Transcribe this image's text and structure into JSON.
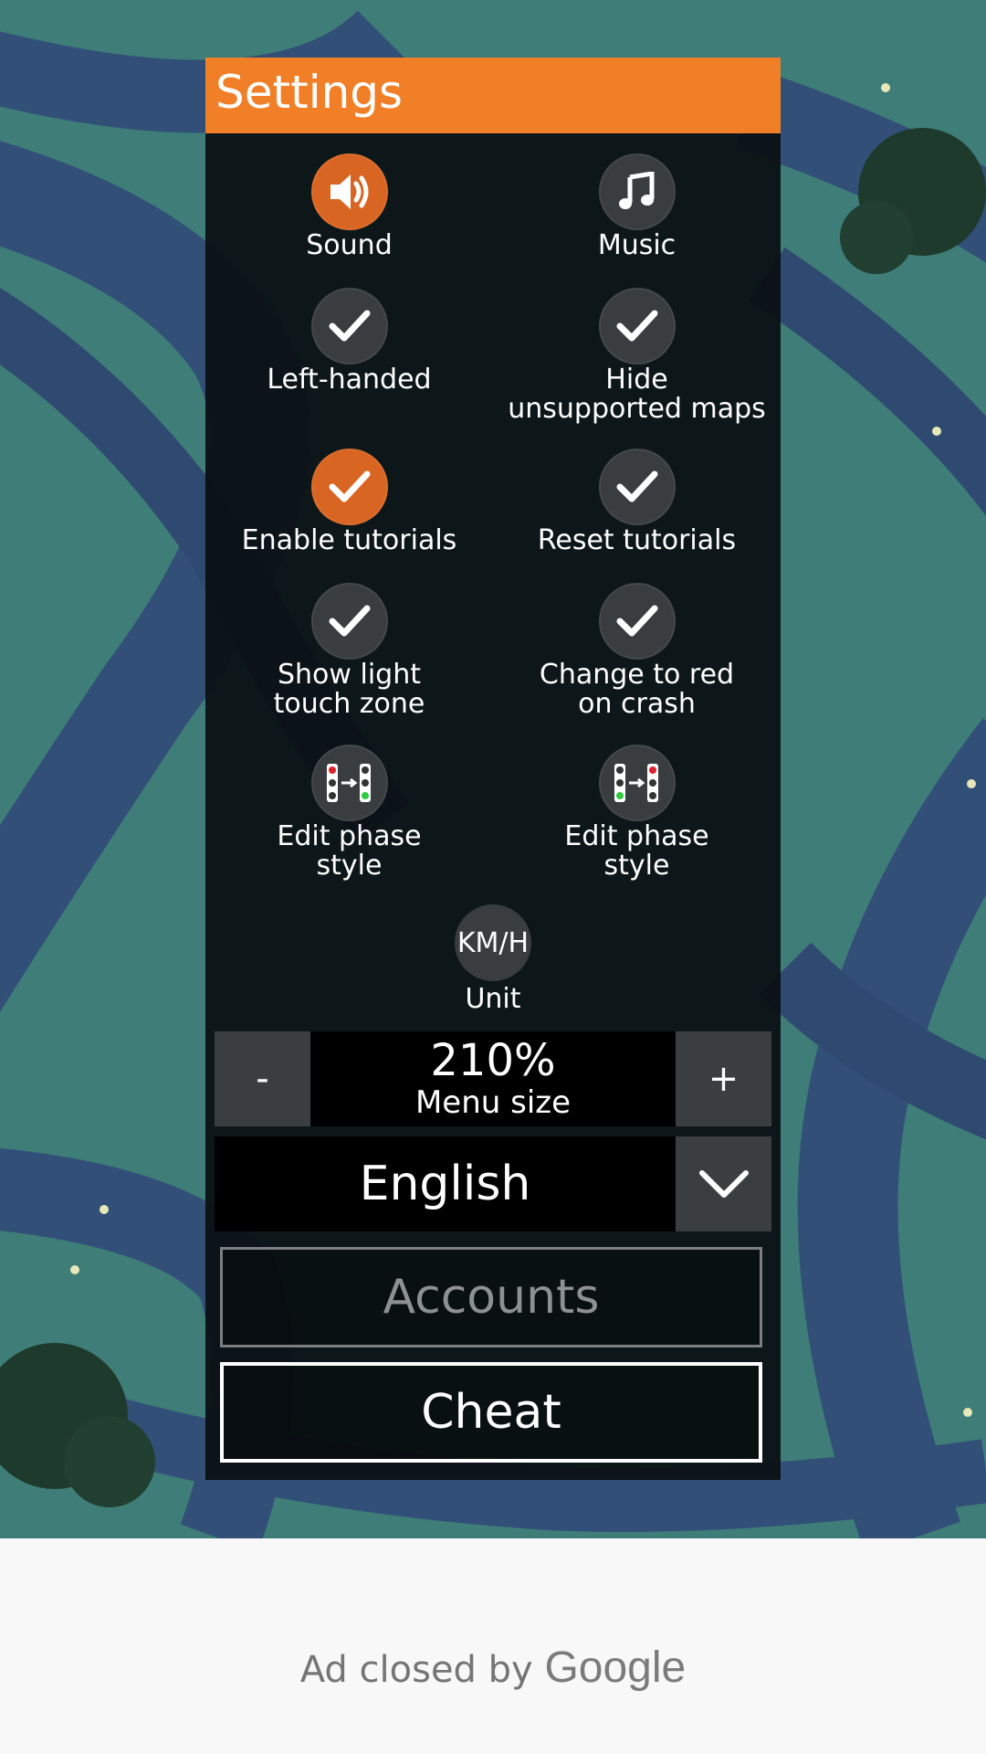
{
  "settings": {
    "title": "Settings",
    "options": [
      {
        "label": "Sound",
        "icon": "speaker-icon",
        "active": true
      },
      {
        "label": "Music",
        "icon": "music-note-icon",
        "active": false
      },
      {
        "label": "Left-handed",
        "icon": "checkmark-icon",
        "active": false
      },
      {
        "label_line1": "Hide",
        "label_line2": "unsupported maps",
        "icon": "checkmark-icon",
        "active": false
      },
      {
        "label": "Enable tutorials",
        "icon": "checkmark-icon",
        "active": true
      },
      {
        "label": "Reset tutorials",
        "icon": "checkmark-icon",
        "active": false
      },
      {
        "label_line1": "Show light",
        "label_line2": "touch zone",
        "icon": "checkmark-icon",
        "active": false
      },
      {
        "label_line1": "Change to red",
        "label_line2": "on crash",
        "icon": "checkmark-icon",
        "active": false
      },
      {
        "label_line1": "Edit phase",
        "label_line2": "style",
        "icon": "traffic-light-phase-icon",
        "active": false
      },
      {
        "label_line1": "Edit phase",
        "label_line2": "style",
        "icon": "traffic-light-phase-icon",
        "active": false
      }
    ],
    "unit": {
      "value": "KM/H",
      "label": "Unit"
    },
    "menu_size": {
      "minus": "-",
      "value": "210%",
      "label": "Menu size",
      "plus": "+"
    },
    "language": {
      "value": "English"
    },
    "accounts_label": "Accounts",
    "cheat_label": "Cheat"
  },
  "ad": {
    "text": "Ad closed by",
    "brand": "Google"
  },
  "colors": {
    "accent": "#f07f27",
    "active_button": "#d96522",
    "panel": "#0c1012",
    "map_grass": "#3f7e78",
    "road": "#33507a"
  }
}
